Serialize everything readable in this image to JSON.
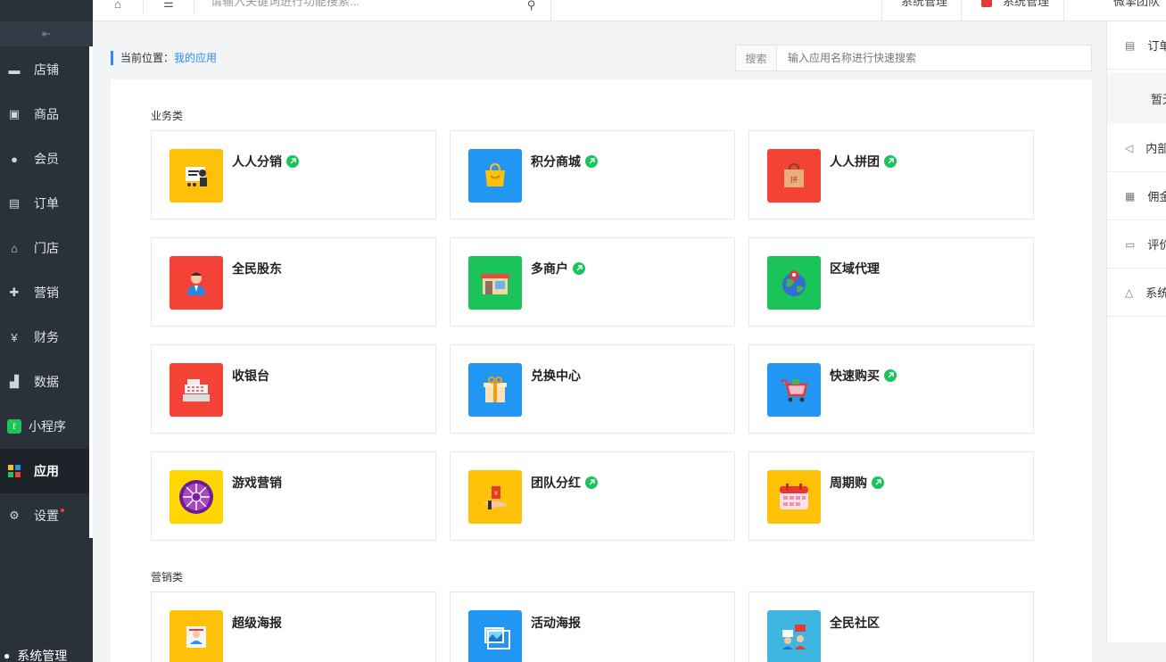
{
  "topbar": {
    "home_icon": "home-icon",
    "menu_icon": "hamburger-icon",
    "search_placeholder": "请输入关键词进行功能搜索...",
    "item1": "系统管理",
    "item2": "系统管理",
    "user": "微擎团队"
  },
  "sidebar": {
    "toggle_icon": "collapse-icon",
    "items": [
      {
        "label": "店铺",
        "icon": "store-icon"
      },
      {
        "label": "商品",
        "icon": "box-icon"
      },
      {
        "label": "会员",
        "icon": "user-icon"
      },
      {
        "label": "订单",
        "icon": "document-icon"
      },
      {
        "label": "门店",
        "icon": "shop-icon"
      },
      {
        "label": "营销",
        "icon": "gift-icon"
      },
      {
        "label": "财务",
        "icon": "moneybag-icon"
      },
      {
        "label": "数据",
        "icon": "chart-icon"
      },
      {
        "label": "小程序",
        "icon": "miniprogram-icon"
      },
      {
        "label": "应用",
        "icon": "apps-icon"
      },
      {
        "label": "设置",
        "icon": "gear-icon"
      }
    ],
    "bottom": "系统管理"
  },
  "breadcrumb": {
    "prefix": "当前位置：",
    "current": "我的应用"
  },
  "search": {
    "label": "搜索",
    "placeholder": "输入应用名称进行快速搜索"
  },
  "sections": {
    "business": "业务类",
    "marketing": "营销类"
  },
  "apps": [
    {
      "name": "人人分销",
      "linked": true,
      "color": "#ffc107"
    },
    {
      "name": "积分商城",
      "linked": true,
      "color": "#2196f3"
    },
    {
      "name": "人人拼团",
      "linked": true,
      "color": "#f44336"
    },
    {
      "name": "全民股东",
      "linked": false,
      "color": "#f44336"
    },
    {
      "name": "多商户",
      "linked": true,
      "color": "#1bc45a"
    },
    {
      "name": "区域代理",
      "linked": false,
      "color": "#1bc45a"
    },
    {
      "name": "收银台",
      "linked": false,
      "color": "#f44336"
    },
    {
      "name": "兑换中心",
      "linked": false,
      "color": "#2196f3"
    },
    {
      "name": "快速购买",
      "linked": true,
      "color": "#2196f3"
    },
    {
      "name": "游戏营销",
      "linked": false,
      "color": "#ffc107"
    },
    {
      "name": "团队分红",
      "linked": true,
      "color": "#ffc107"
    },
    {
      "name": "周期购",
      "linked": true,
      "color": "#ffc107"
    },
    {
      "name": "超级海报",
      "linked": false,
      "color": "#ffc107"
    },
    {
      "name": "活动海报",
      "linked": false,
      "color": "#2196f3"
    },
    {
      "name": "全民社区",
      "linked": false,
      "color": "#3fb6e0"
    }
  ],
  "drawer": {
    "items": [
      {
        "label": "订单",
        "icon": "clipboard-icon"
      },
      {
        "label": "暂无",
        "icon": ""
      },
      {
        "label": "内部",
        "icon": "speaker-icon"
      },
      {
        "label": "佣金",
        "icon": "receipt-icon"
      },
      {
        "label": "评价",
        "icon": "comment-icon"
      },
      {
        "label": "系统",
        "icon": "bell-icon"
      }
    ]
  }
}
